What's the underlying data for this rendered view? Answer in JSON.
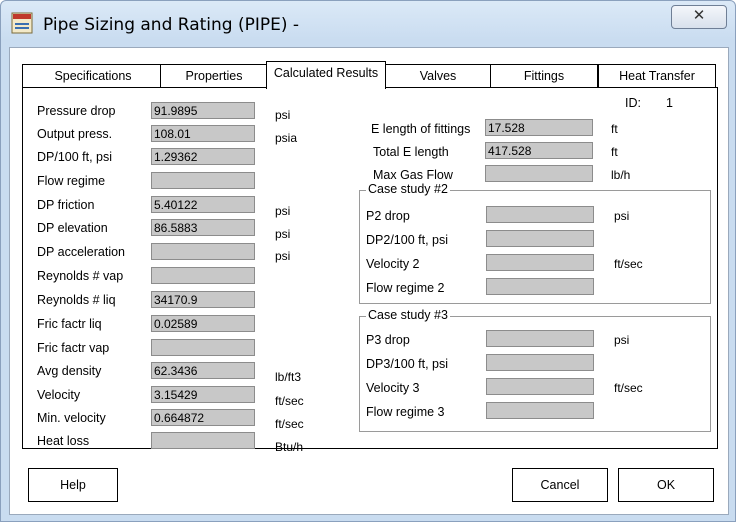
{
  "window": {
    "title": "Pipe Sizing and Rating (PIPE)  -",
    "close_glyph": "✕"
  },
  "tabs": [
    "Specifications",
    "Properties",
    "Calculated Results",
    "Valves",
    "Fittings",
    "Heat Transfer"
  ],
  "id": {
    "label": "ID:",
    "value": "1"
  },
  "left": [
    {
      "label": "Pressure drop",
      "value": "91.9895",
      "unit": "psi"
    },
    {
      "label": "Output press.",
      "value": "108.01",
      "unit": "psia"
    },
    {
      "label": "DP/100 ft, psi",
      "value": "1.29362",
      "unit": ""
    },
    {
      "label": "Flow regime",
      "value": "",
      "unit": ""
    },
    {
      "label": "DP friction",
      "value": "5.40122",
      "unit": "psi"
    },
    {
      "label": "DP elevation",
      "value": "86.5883",
      "unit": "psi"
    },
    {
      "label": "DP acceleration",
      "value": "",
      "unit": "psi"
    },
    {
      "label": "Reynolds # vap",
      "value": "",
      "unit": ""
    },
    {
      "label": "Reynolds # liq",
      "value": "34170.9",
      "unit": ""
    },
    {
      "label": "Fric factr liq",
      "value": "0.02589",
      "unit": ""
    },
    {
      "label": "Fric factr vap",
      "value": "",
      "unit": ""
    },
    {
      "label": "Avg density",
      "value": "62.3436",
      "unit": "lb/ft3"
    },
    {
      "label": "Velocity",
      "value": "3.15429",
      "unit": "ft/sec"
    },
    {
      "label": "Min. velocity",
      "value": "0.664872",
      "unit": "ft/sec"
    },
    {
      "label": "Heat loss",
      "value": "",
      "unit": "Btu/h"
    }
  ],
  "right_top": [
    {
      "label": "E length of fittings",
      "value": "17.528",
      "unit": "ft"
    },
    {
      "label": "Total E length",
      "value": "417.528",
      "unit": "ft"
    },
    {
      "label": "Max Gas Flow",
      "value": "",
      "unit": "lb/h"
    }
  ],
  "case2": {
    "title": "Case study #2",
    "rows": [
      {
        "label": "P2 drop",
        "value": "",
        "unit": "psi"
      },
      {
        "label": "DP2/100 ft, psi",
        "value": "",
        "unit": ""
      },
      {
        "label": "Velocity 2",
        "value": "",
        "unit": "ft/sec"
      },
      {
        "label": "Flow regime 2",
        "value": "",
        "unit": ""
      }
    ]
  },
  "case3": {
    "title": "Case study #3",
    "rows": [
      {
        "label": "P3 drop",
        "value": "",
        "unit": "psi"
      },
      {
        "label": "DP3/100 ft, psi",
        "value": "",
        "unit": ""
      },
      {
        "label": "Velocity 3",
        "value": "",
        "unit": "ft/sec"
      },
      {
        "label": "Flow regime 3",
        "value": "",
        "unit": ""
      }
    ]
  },
  "buttons": {
    "help": "Help",
    "cancel": "Cancel",
    "ok": "OK"
  }
}
